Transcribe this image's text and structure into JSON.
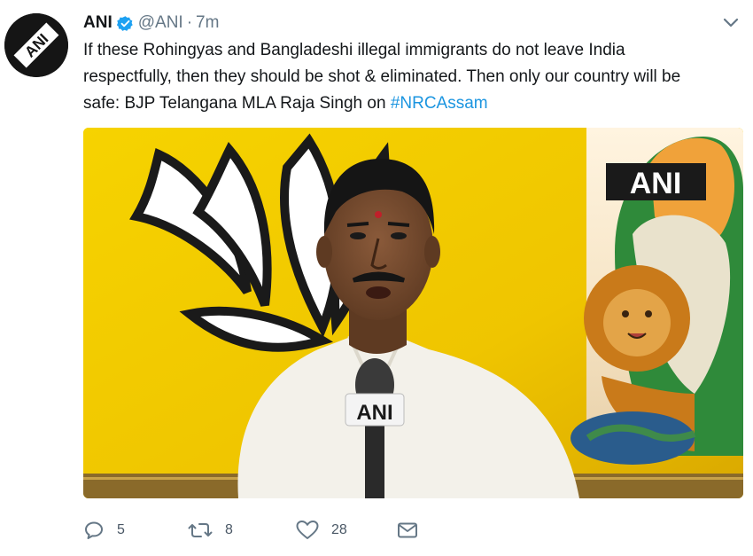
{
  "author": {
    "name": "ANI",
    "handle": "@ANI",
    "separator": "·",
    "time": "7m",
    "avatar_text": "ANI",
    "verified_icon": "verified-badge-icon"
  },
  "tweet": {
    "text_line1": "If these Rohingyas and Bangladeshi illegal immigrants do not leave India",
    "text_line2": "respectfully, then they should be shot & eliminated. Then only our country will be",
    "text_line3_prefix": "safe: BJP Telangana MLA Raja Singh on ",
    "hashtag": "#NRCAssam"
  },
  "media": {
    "watermark": "ANI",
    "mic_label": "ANI"
  },
  "actions": {
    "reply_count": "5",
    "retweet_count": "8",
    "like_count": "28",
    "reply_icon": "reply-icon",
    "retweet_icon": "retweet-icon",
    "like_icon": "heart-icon",
    "dm_icon": "envelope-icon"
  },
  "colors": {
    "link": "#1b95e0",
    "muted": "#657786",
    "verified": "#1da1f2"
  }
}
